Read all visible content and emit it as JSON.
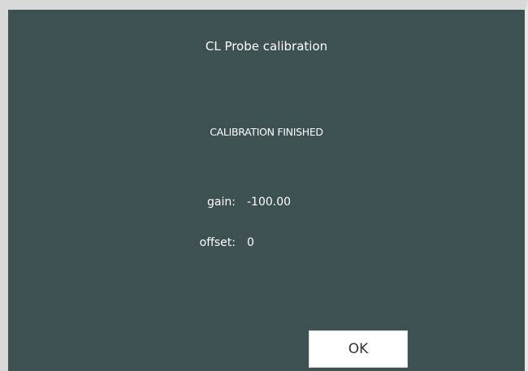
{
  "dialog": {
    "title": "CL Probe calibration",
    "status": "CALIBRATION FINISHED",
    "fields": {
      "gain_label": "gain:",
      "gain_value": "-100.00",
      "offset_label": "offset:",
      "offset_value": "0"
    },
    "ok_label": "OK"
  },
  "colors": {
    "dialog_background": "#3d5052",
    "frame": "#d9d9d9",
    "text": "#ffffff",
    "button_background": "#ffffff"
  }
}
